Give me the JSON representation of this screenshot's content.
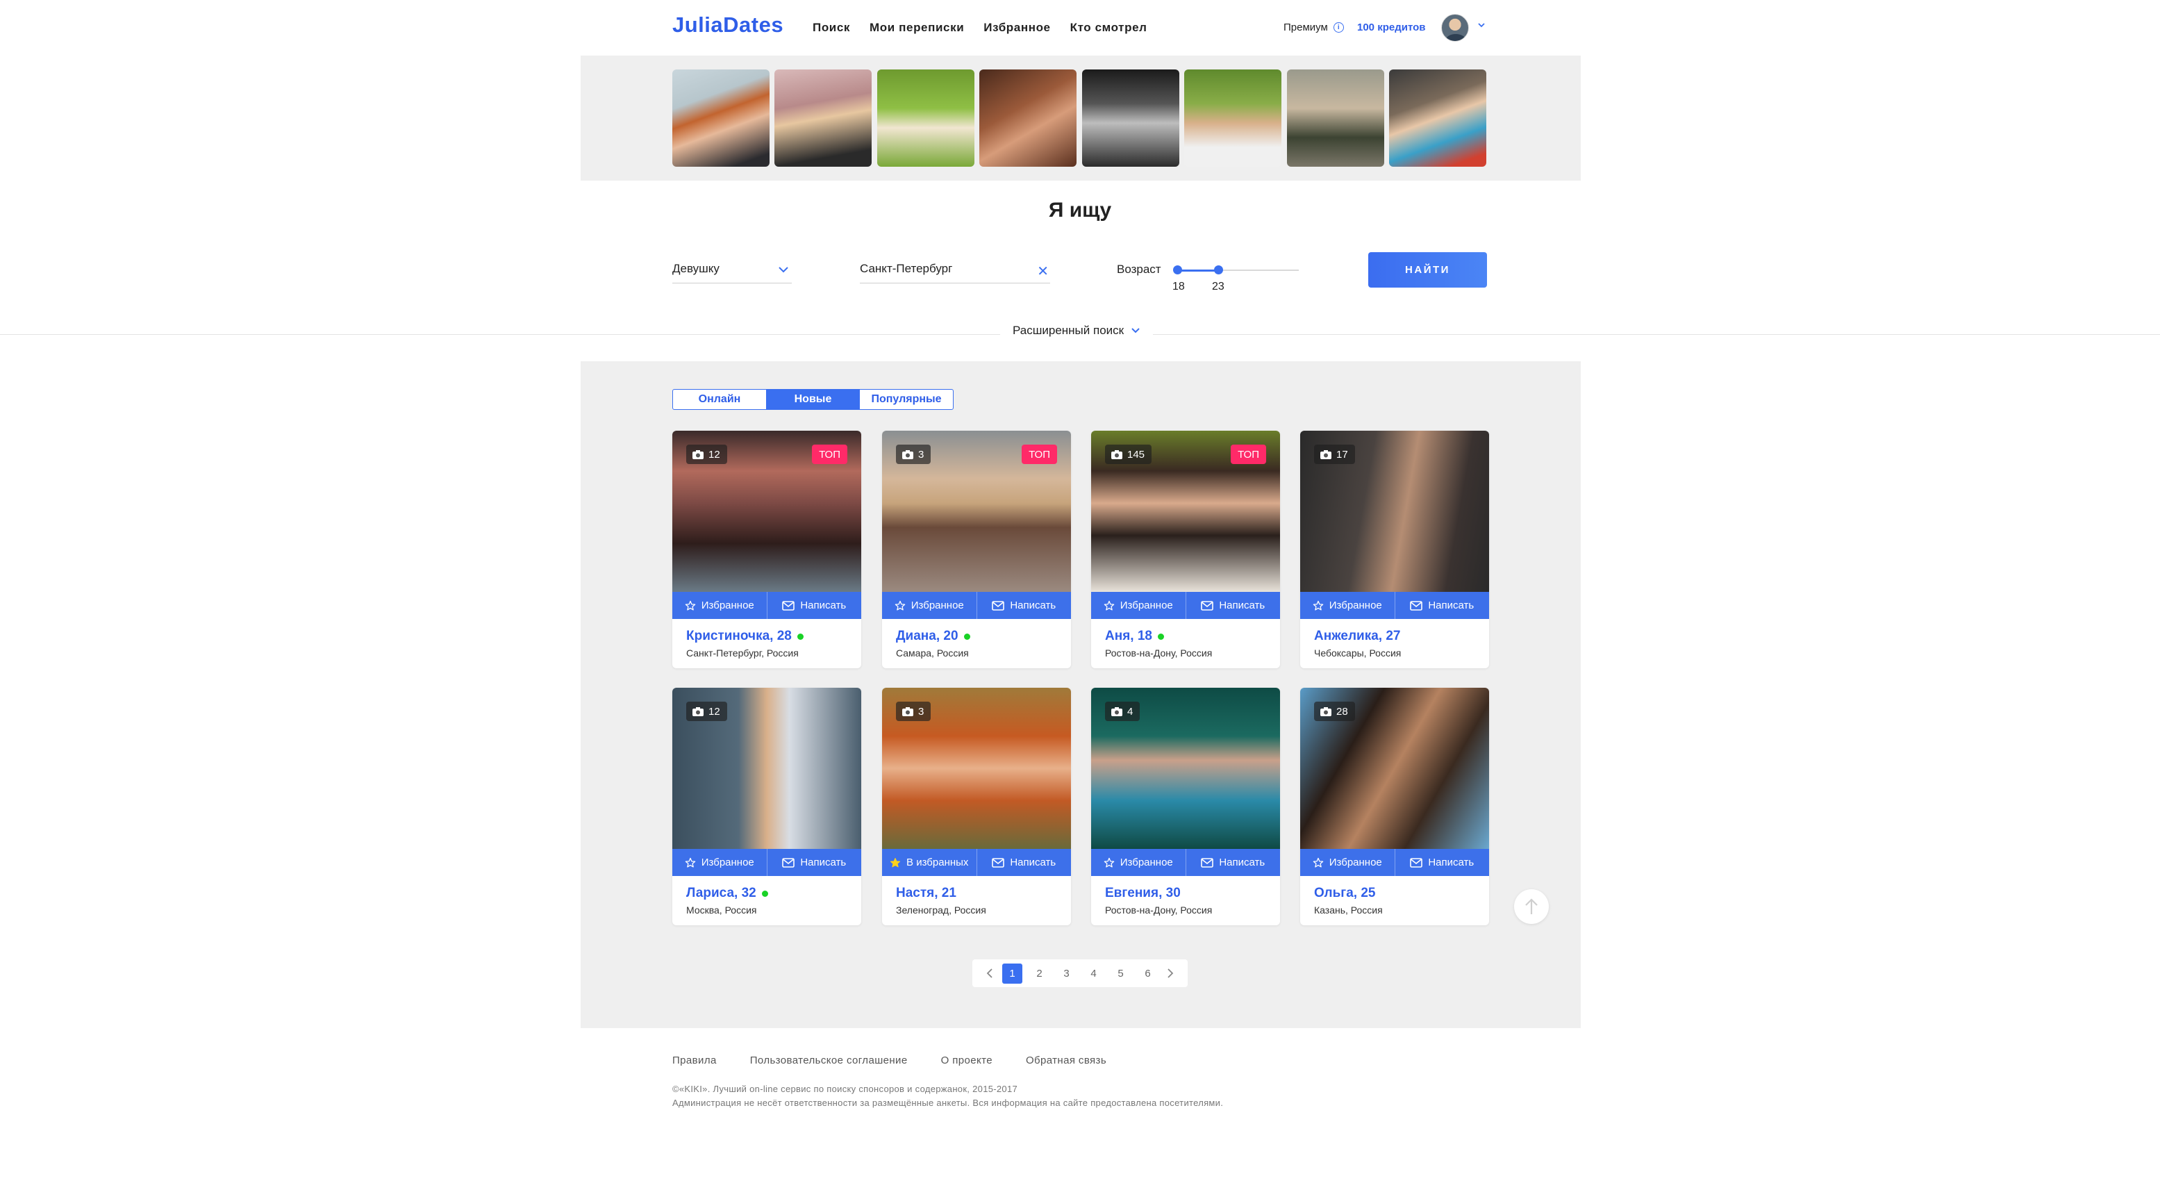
{
  "header": {
    "logo": "JuliaDates",
    "nav": [
      "Поиск",
      "Мои переписки",
      "Избранное",
      "Кто смотрел"
    ],
    "premium_label": "Премиум",
    "credits": "100 кредитов"
  },
  "search": {
    "title": "Я ищу",
    "gender_value": "Девушку",
    "city_value": "Санкт-Петербург",
    "age_label": "Возраст",
    "age_min": "18",
    "age_max": "23",
    "find_label": "НАЙТИ",
    "advanced_label": "Расширенный поиск"
  },
  "tabs": [
    "Онлайн",
    "Новые",
    "Популярные"
  ],
  "active_tab": "Новые",
  "card_actions": {
    "favorite": "Избранное",
    "in_favorites": "В избранных",
    "write": "Написать"
  },
  "top_badge": "ТОП",
  "cards": [
    {
      "name": "Кристиночка, 28",
      "location": "Санкт-Петербург, Россия",
      "photos": "12",
      "top": true,
      "online": true,
      "in_favorites": false
    },
    {
      "name": "Диана, 20",
      "location": "Самара, Россия",
      "photos": "3",
      "top": true,
      "online": true,
      "in_favorites": false
    },
    {
      "name": "Аня, 18",
      "location": "Ростов-на-Дону, Россия",
      "photos": "145",
      "top": true,
      "online": true,
      "in_favorites": false
    },
    {
      "name": "Анжелика, 27",
      "location": "Чебоксары, Россия",
      "photos": "17",
      "top": false,
      "online": false,
      "in_favorites": false
    },
    {
      "name": "Лариса, 32",
      "location": "Москва, Россия",
      "photos": "12",
      "top": false,
      "online": true,
      "in_favorites": false
    },
    {
      "name": "Настя, 21",
      "location": "Зеленоград, Россия",
      "photos": "3",
      "top": false,
      "online": false,
      "in_favorites": true
    },
    {
      "name": "Евгения, 30",
      "location": "Ростов-на-Дону, Россия",
      "photos": "4",
      "top": false,
      "online": false,
      "in_favorites": false
    },
    {
      "name": "Ольга, 25",
      "location": "Казань, Россия",
      "photos": "28",
      "top": false,
      "online": false,
      "in_favorites": false
    }
  ],
  "pagination": {
    "pages": [
      "1",
      "2",
      "3",
      "4",
      "5",
      "6"
    ],
    "current": "1"
  },
  "footer": {
    "links": [
      "Правила",
      "Пользовательское соглашение",
      "О проекте",
      "Обратная связь"
    ],
    "copyright": "©«KIKI». Лучший on-line сервис по поиску спонсоров и содержанок, 2015-2017",
    "disclaimer": "Администрация не несёт ответственности за размещённые анкеты. Вся информация на сайте предоставлена посетителями."
  },
  "colors": {
    "accent": "#3a6ff0",
    "top_badge": "#ff2a68",
    "online": "#19d226",
    "panel": "#efefef"
  },
  "icons": [
    "info-icon",
    "chevron-down-icon",
    "close-icon",
    "camera-icon",
    "star-icon",
    "envelope-icon",
    "arrow-up-icon",
    "chevron-left-icon",
    "chevron-right-icon"
  ]
}
